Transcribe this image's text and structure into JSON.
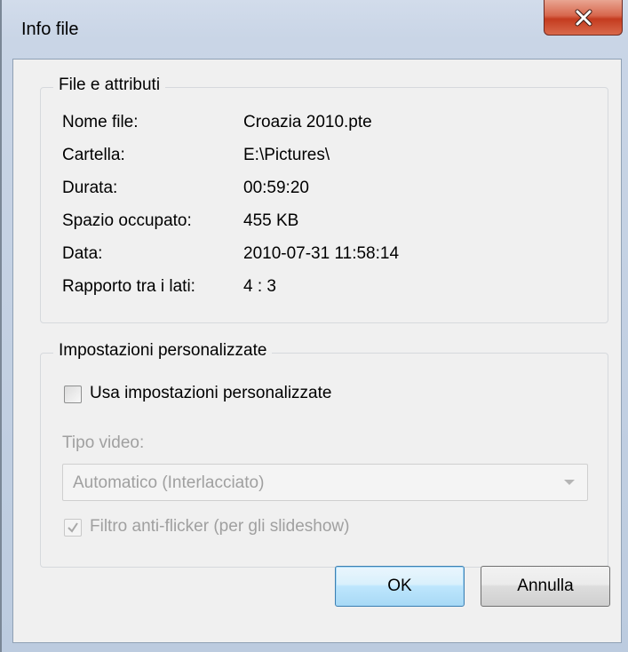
{
  "window": {
    "title": "Info file",
    "close_label": "X"
  },
  "file_group": {
    "legend": "File e attributi",
    "rows": [
      {
        "label": "Nome file:",
        "value": "Croazia 2010.pte"
      },
      {
        "label": "Cartella:",
        "value": "E:\\Pictures\\"
      },
      {
        "label": "Durata:",
        "value": "00:59:20"
      },
      {
        "label": "Spazio occupato:",
        "value": "455 KB"
      },
      {
        "label": "Data:",
        "value": "2010-07-31  11:58:14"
      },
      {
        "label": "Rapporto tra i lati:",
        "value": "4 : 3"
      }
    ]
  },
  "custom_group": {
    "legend": "Impostazioni personalizzate",
    "use_custom": {
      "label": "Usa impostazioni personalizzate",
      "checked": false
    },
    "video_type": {
      "label": "Tipo video:",
      "selected": "Automatico (Interlacciato)",
      "disabled": true
    },
    "antiflicker": {
      "label": "Filtro anti-flicker (per gli slideshow)",
      "checked": true,
      "disabled": true
    }
  },
  "buttons": {
    "ok": "OK",
    "cancel": "Annulla"
  },
  "colors": {
    "close_button": "#c43b1f",
    "disabled_text": "#a0a0a0",
    "default_button_border": "#3c7fb1"
  }
}
